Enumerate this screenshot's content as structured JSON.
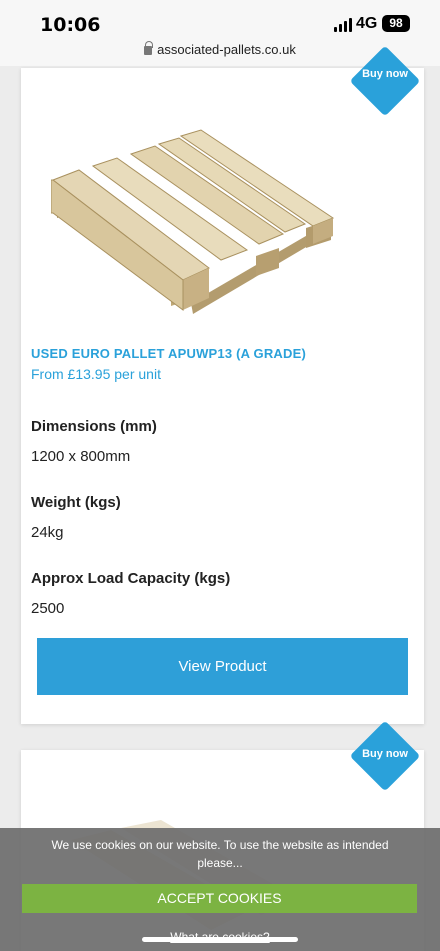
{
  "status_bar": {
    "time": "10:06",
    "network": "4G",
    "battery": "98"
  },
  "browser": {
    "url": "associated-pallets.co.uk"
  },
  "products": [
    {
      "badge": "Buy now",
      "title": "USED EURO PALLET APUWP13 (A GRADE)",
      "price": "From £13.95 per unit",
      "specs": [
        {
          "label": "Dimensions (mm)",
          "value": "1200 x 800mm"
        },
        {
          "label": "Weight (kgs)",
          "value": "24kg"
        },
        {
          "label": "Approx Load Capacity (kgs)",
          "value": "2500"
        }
      ],
      "button": "View Product"
    },
    {
      "badge": "Buy now"
    }
  ],
  "cookie_banner": {
    "text": "We use cookies on our website. To use the website as intended please...",
    "accept": "ACCEPT COOKIES",
    "link": "What are cookies?"
  },
  "colors": {
    "brand_blue": "#2aa1da",
    "accept_green": "#7cb342"
  }
}
